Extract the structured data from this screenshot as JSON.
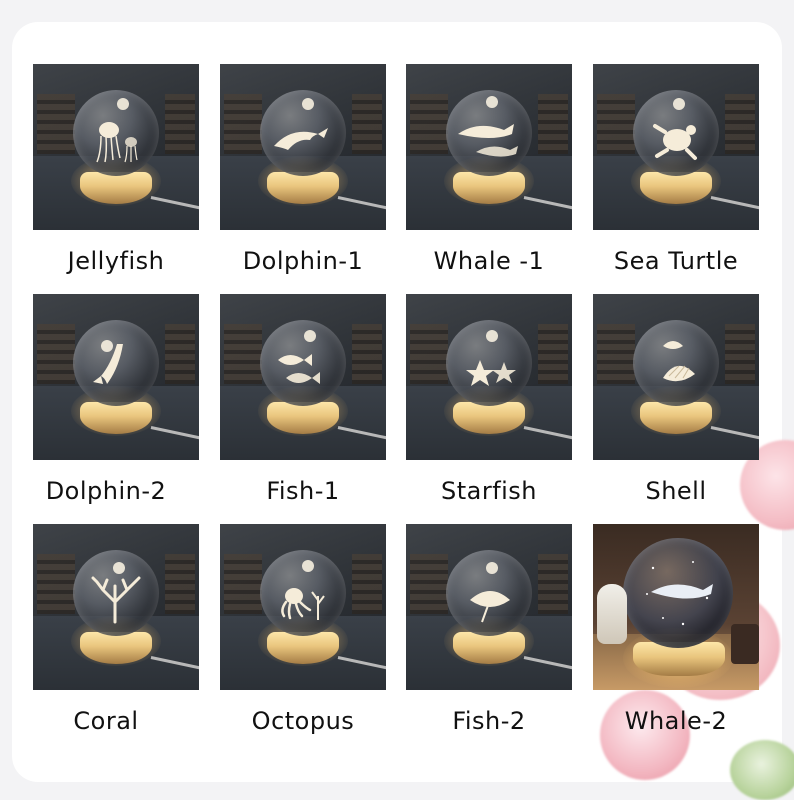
{
  "items": [
    {
      "label": "Jellyfish",
      "motif": "jellyfish-icon"
    },
    {
      "label": "Dolphin-1",
      "motif": "dolphin-icon"
    },
    {
      "label": "Whale -1",
      "motif": "whale-icon"
    },
    {
      "label": "Sea Turtle",
      "motif": "sea-turtle-icon"
    },
    {
      "label": "Dolphin-2",
      "motif": "dolphin-icon"
    },
    {
      "label": "Fish-1",
      "motif": "fish-icon"
    },
    {
      "label": "Starfish",
      "motif": "starfish-icon"
    },
    {
      "label": "Shell",
      "motif": "shell-icon"
    },
    {
      "label": "Coral",
      "motif": "coral-icon"
    },
    {
      "label": "Octopus",
      "motif": "octopus-icon"
    },
    {
      "label": "Fish-2",
      "motif": "fish-icon"
    },
    {
      "label": "Whale-2",
      "motif": "whale-icon"
    }
  ],
  "colors": {
    "background": "#f3f3f5",
    "panel": "#ffffff",
    "label_text": "#111111",
    "lamp_glow": "#fde6a8",
    "flower": "#f4bcc4"
  }
}
